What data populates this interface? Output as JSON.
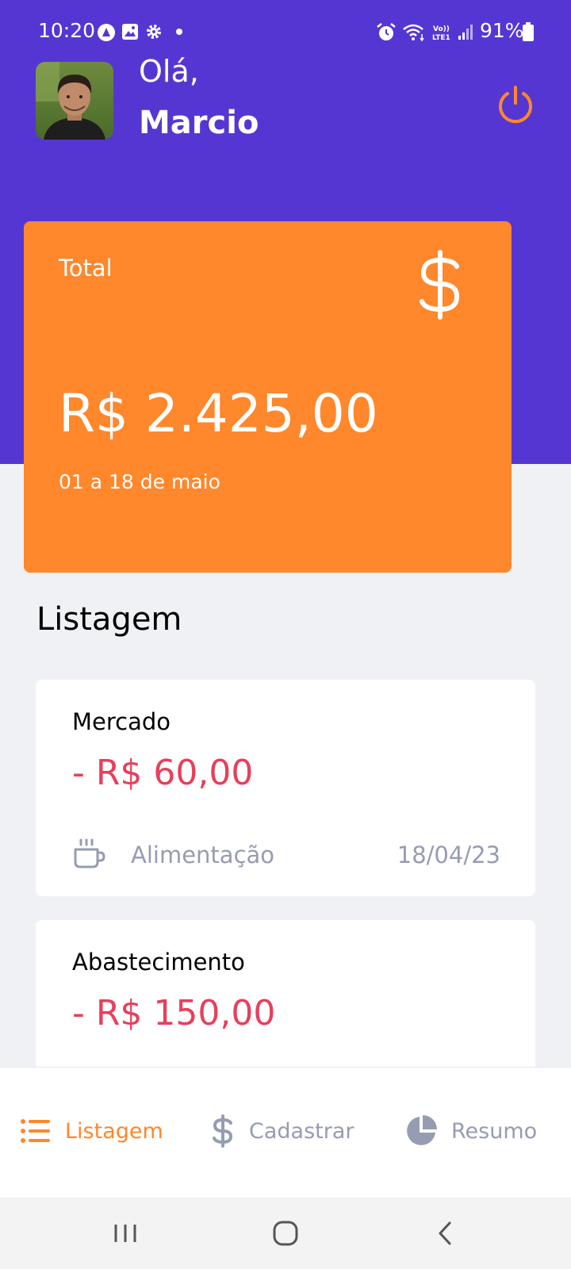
{
  "status_bar": {
    "time": "10:20",
    "battery": "91%"
  },
  "header": {
    "greeting": "Olá,",
    "user_name": "Marcio",
    "power_icon": "power-icon"
  },
  "total_card": {
    "label": "Total",
    "icon": "dollar-sign-icon",
    "amount": "R$ 2.425,00",
    "period": "01 a 18 de maio"
  },
  "list": {
    "title": "Listagem",
    "transactions": [
      {
        "title": "Mercado",
        "amount": "- R$ 60,00",
        "category": "Alimentação",
        "category_icon": "coffee-icon",
        "date": "18/04/23"
      },
      {
        "title": "Abastecimento",
        "amount": "- R$ 150,00"
      }
    ]
  },
  "tab_bar": {
    "tabs": [
      {
        "label": "Listagem",
        "icon": "list-icon",
        "active": true
      },
      {
        "label": "Cadastrar",
        "icon": "dollar-sign-icon",
        "active": false
      },
      {
        "label": "Resumo",
        "icon": "pie-chart-icon",
        "active": false
      }
    ]
  },
  "colors": {
    "primary": "#5636D3",
    "secondary": "#FF872C",
    "attention": "#E83F5B",
    "text_muted": "#969CB2",
    "background": "#F0F1F5"
  }
}
